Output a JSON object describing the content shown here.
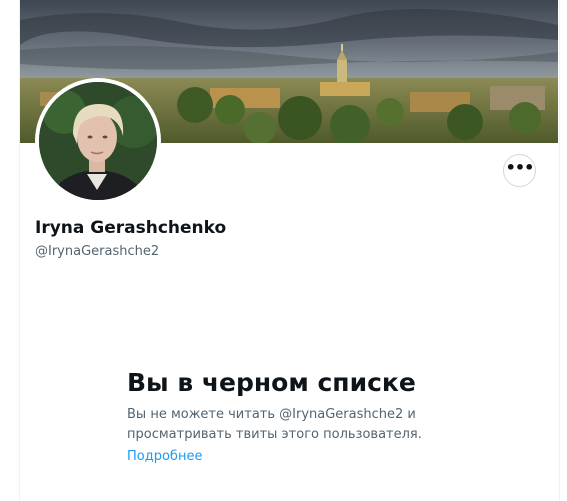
{
  "profile": {
    "display_name": "Iryna Gerashchenko",
    "handle": "@IrynaGerashche2",
    "banner_icon": "city-skyline-photo",
    "avatar_icon": "profile-photo"
  },
  "actions": {
    "more_label": "•••",
    "more_icon": "more-horizontal-icon"
  },
  "blocked": {
    "title": "Вы в черном списке",
    "line1": "Вы не можете читать @IrynaGerashche2 и",
    "line2": "просматривать твиты этого пользователя.",
    "link": "Подробнее"
  },
  "colors": {
    "text_primary": "#0f1419",
    "text_secondary": "#536471",
    "link": "#1d9bf0",
    "border": "#cfd9de"
  }
}
